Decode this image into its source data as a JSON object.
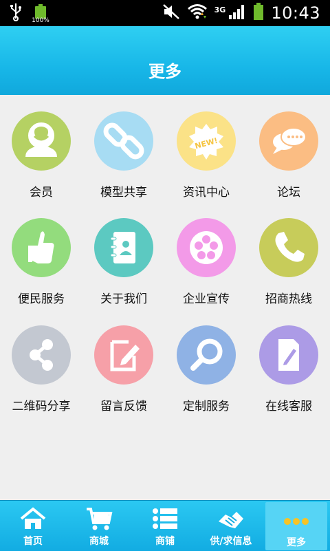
{
  "status_bar": {
    "battery_percent": "100%",
    "network": "3G",
    "time": "10:43"
  },
  "header": {
    "title": "更多"
  },
  "menu": [
    {
      "label": "会员",
      "icon": "member-icon",
      "color": "#b5d163"
    },
    {
      "label": "模型共享",
      "icon": "link-icon",
      "color": "#a7dcf3"
    },
    {
      "label": "资讯中心",
      "icon": "news-icon",
      "color": "#fbe287"
    },
    {
      "label": "论坛",
      "icon": "forum-icon",
      "color": "#fbbd83"
    },
    {
      "label": "便民服务",
      "icon": "thumbs-up-icon",
      "color": "#93dc7d"
    },
    {
      "label": "关于我们",
      "icon": "contact-book-icon",
      "color": "#5cc9c1"
    },
    {
      "label": "企业宣传",
      "icon": "film-reel-icon",
      "color": "#f39ae8"
    },
    {
      "label": "招商热线",
      "icon": "phone-icon",
      "color": "#c7cc5a"
    },
    {
      "label": "二维码分享",
      "icon": "share-icon",
      "color": "#c3c8d1"
    },
    {
      "label": "留言反馈",
      "icon": "edit-icon",
      "color": "#f6a0a8"
    },
    {
      "label": "定制服务",
      "icon": "magnifier-icon",
      "color": "#8fb2e5"
    },
    {
      "label": "在线客服",
      "icon": "document-edit-icon",
      "color": "#ac9be6"
    }
  ],
  "tabs": [
    {
      "label": "首页",
      "icon": "home-icon"
    },
    {
      "label": "商城",
      "icon": "cart-icon"
    },
    {
      "label": "商铺",
      "icon": "list-icon"
    },
    {
      "label": "供/求信息",
      "icon": "handshake-icon"
    },
    {
      "label": "更多",
      "icon": "more-dots-icon",
      "active": true
    }
  ],
  "colors": {
    "header": "#18b7e8",
    "tabbar": "#12ace2",
    "tab_active": "#56d4f5"
  }
}
